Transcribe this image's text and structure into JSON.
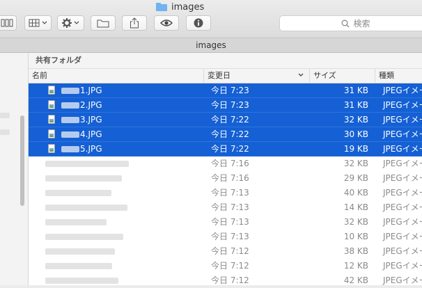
{
  "window": {
    "title": "images",
    "path_label": "images"
  },
  "toolbar": {
    "search_placeholder": "検索",
    "buttons": [
      {
        "icon": "column-view-icon"
      },
      {
        "icon": "group-view-icon"
      },
      {
        "icon": "gear-icon"
      },
      {
        "icon": "new-folder-icon"
      },
      {
        "icon": "share-icon"
      },
      {
        "icon": "eye-icon"
      },
      {
        "icon": "info-icon"
      }
    ]
  },
  "list": {
    "group_label": "共有フォルダ",
    "columns": {
      "name": "名前",
      "date": "変更日",
      "size": "サイズ",
      "kind": "種類"
    },
    "rows": [
      {
        "name": "1.JPG",
        "date": "今日 7:23",
        "size": "31 KB",
        "kind": "JPEGイメージ",
        "selected": true
      },
      {
        "name": "2.JPG",
        "date": "今日 7:23",
        "size": "31 KB",
        "kind": "JPEGイメージ",
        "selected": true
      },
      {
        "name": "3.JPG",
        "date": "今日 7:22",
        "size": "32 KB",
        "kind": "JPEGイメージ",
        "selected": true
      },
      {
        "name": "4.JPG",
        "date": "今日 7:22",
        "size": "30 KB",
        "kind": "JPEGイメージ",
        "selected": true
      },
      {
        "name": "5.JPG",
        "date": "今日 7:22",
        "size": "19 KB",
        "kind": "JPEGイメージ",
        "selected": true
      },
      {
        "name": "",
        "date": "今日 7:16",
        "size": "32 KB",
        "kind": "JPEGイメージ",
        "selected": false
      },
      {
        "name": "",
        "date": "今日 7:16",
        "size": "29 KB",
        "kind": "JPEGイメージ",
        "selected": false
      },
      {
        "name": "",
        "date": "今日 7:13",
        "size": "40 KB",
        "kind": "JPEGイメージ",
        "selected": false
      },
      {
        "name": "",
        "date": "今日 7:13",
        "size": "14 KB",
        "kind": "JPEGイメージ",
        "selected": false
      },
      {
        "name": "",
        "date": "今日 7:13",
        "size": "32 KB",
        "kind": "JPEGイメージ",
        "selected": false
      },
      {
        "name": "",
        "date": "今日 7:13",
        "size": "10 KB",
        "kind": "JPEGイメージ",
        "selected": false
      },
      {
        "name": "",
        "date": "今日 7:12",
        "size": "38 KB",
        "kind": "JPEGイメージ",
        "selected": false
      },
      {
        "name": "",
        "date": "今日 7:12",
        "size": "12 KB",
        "kind": "JPEGイメージ",
        "selected": false
      },
      {
        "name": "",
        "date": "今日 7:12",
        "size": "42 KB",
        "kind": "JPEGイメージ",
        "selected": false
      }
    ]
  },
  "colors": {
    "selection": "#1560d4",
    "folder": "#6fb3f0"
  }
}
